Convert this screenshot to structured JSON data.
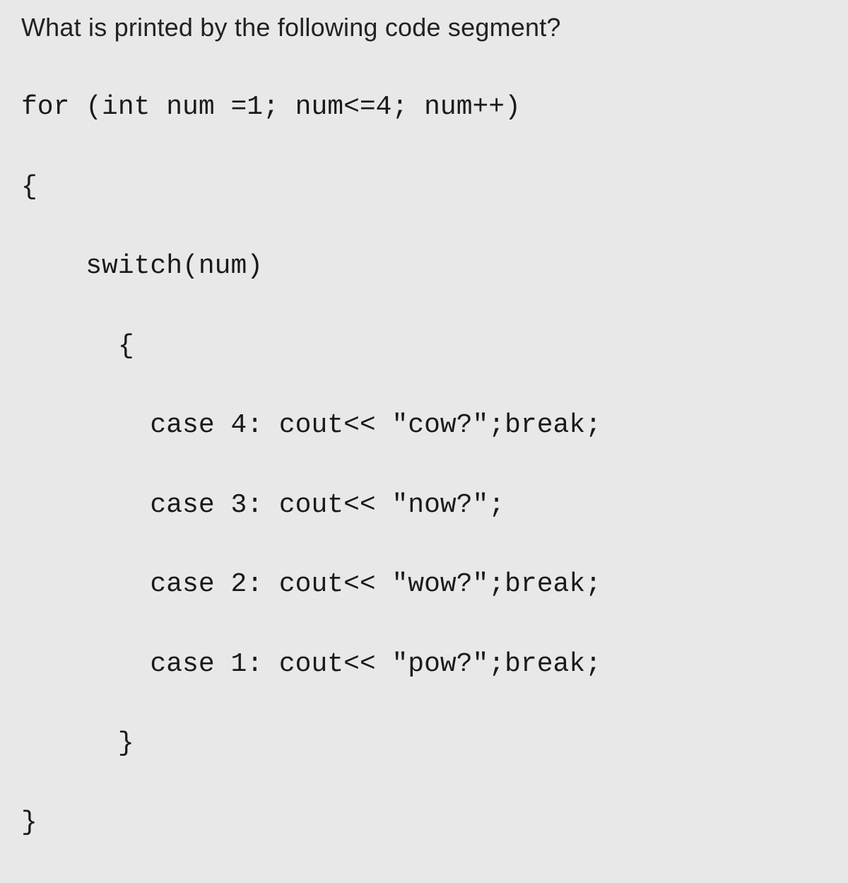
{
  "question": "What is printed by the following code segment?",
  "code": {
    "line1": "for (int num =1; num<=4; num++)",
    "line2": "{",
    "line3": "    switch(num)",
    "line4": "      {",
    "line5": "        case 4: cout<< \"cow?\";break;",
    "line6": "        case 3: cout<< \"now?\";",
    "line7": "        case 2: cout<< \"wow?\";break;",
    "line8": "        case 1: cout<< \"pow?\";break;",
    "line9": "      }",
    "line10": "}"
  }
}
